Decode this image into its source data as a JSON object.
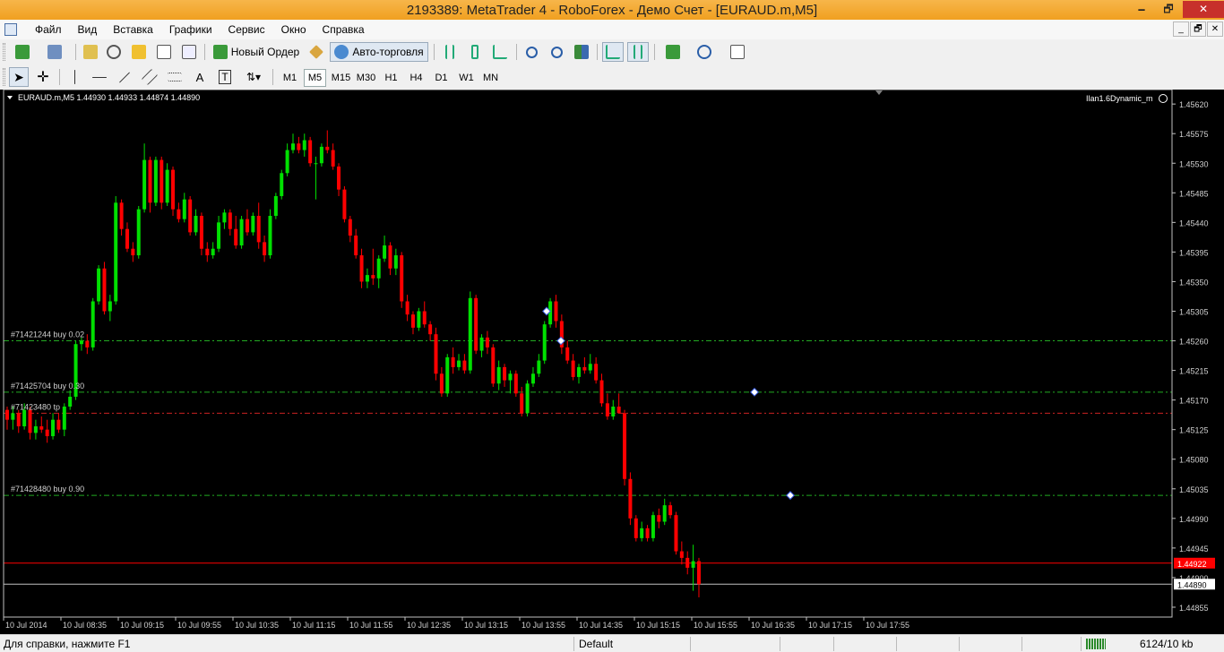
{
  "window": {
    "title": "2193389: MetaTrader 4 - RoboForex - Демо Счет - [EURAUD.m,M5]",
    "minimize": "🗕",
    "maximize": "🗗",
    "close": "✕"
  },
  "menu": {
    "items": [
      "Файл",
      "Вид",
      "Вставка",
      "Графики",
      "Сервис",
      "Окно",
      "Справка"
    ],
    "mdi": [
      "_",
      "🗗",
      "✕"
    ]
  },
  "toolbar": {
    "new_order": "Новый Ордер",
    "auto_trading": "Авто-торговля",
    "timeframes": [
      "M1",
      "M5",
      "M15",
      "M30",
      "H1",
      "H4",
      "D1",
      "W1",
      "MN"
    ],
    "active_timeframe": "M5",
    "search_placeholder": ""
  },
  "chart": {
    "header": "EURAUD.m,M5  1.44930 1.44933 1.44874 1.44890",
    "expert": "Ilan1.6Dynamic_m",
    "colors": {
      "background": "#000000",
      "bull": "#00e000",
      "bear": "#ff0000",
      "order_line": "#22aa22",
      "tp_line": "#cc2222",
      "bid_line": "#ff0000",
      "ask_line": "#c0c0c0"
    },
    "order_labels": [
      {
        "text": "#71421244 buy 0.02",
        "price": 1.4526
      },
      {
        "text": "#71425704 buy 0.30",
        "price": 1.45182
      },
      {
        "text": "#71423480 tp",
        "price": 1.4515
      },
      {
        "text": "#71428480 buy 0.90",
        "price": 1.45025
      }
    ],
    "bid_price_label": "1.44922",
    "ask_price_label": "1.44890",
    "bid_price": 1.44922,
    "ask_price": 1.4489,
    "price_ticks": [
      "1.45620",
      "1.45575",
      "1.45530",
      "1.45485",
      "1.45440",
      "1.45395",
      "1.45350",
      "1.45305",
      "1.45260",
      "1.45215",
      "1.45170",
      "1.45125",
      "1.45080",
      "1.45035",
      "1.44990",
      "1.44945",
      "1.44900",
      "1.44855"
    ],
    "time_ticks": [
      "10 Jul 2014",
      "10 Jul 08:35",
      "10 Jul 09:15",
      "10 Jul 09:55",
      "10 Jul 10:35",
      "10 Jul 11:15",
      "10 Jul 11:55",
      "10 Jul 12:35",
      "10 Jul 13:15",
      "10 Jul 13:55",
      "10 Jul 14:35",
      "10 Jul 15:15",
      "10 Jul 15:55",
      "10 Jul 16:35",
      "10 Jul 17:15",
      "10 Jul 17:55"
    ],
    "candles": [
      [
        1.45155,
        1.4516,
        1.45125,
        1.4514
      ],
      [
        1.4514,
        1.4516,
        1.45125,
        1.4515
      ],
      [
        1.4515,
        1.45155,
        1.4512,
        1.4513
      ],
      [
        1.4513,
        1.45165,
        1.45125,
        1.45155
      ],
      [
        1.45155,
        1.4516,
        1.4511,
        1.4512
      ],
      [
        1.4512,
        1.4514,
        1.4511,
        1.4513
      ],
      [
        1.4513,
        1.45145,
        1.4512,
        1.45125
      ],
      [
        1.45125,
        1.4514,
        1.45105,
        1.45115
      ],
      [
        1.45115,
        1.4515,
        1.4511,
        1.4514
      ],
      [
        1.4514,
        1.4515,
        1.4512,
        1.45125
      ],
      [
        1.45125,
        1.45165,
        1.45115,
        1.4516
      ],
      [
        1.4516,
        1.45185,
        1.45155,
        1.45175
      ],
      [
        1.45175,
        1.4526,
        1.4517,
        1.45255
      ],
      [
        1.45255,
        1.45265,
        1.45245,
        1.4526
      ],
      [
        1.4526,
        1.4527,
        1.4524,
        1.4525
      ],
      [
        1.4525,
        1.45325,
        1.45245,
        1.4532
      ],
      [
        1.4532,
        1.45375,
        1.45315,
        1.4537
      ],
      [
        1.4537,
        1.4538,
        1.453,
        1.45305
      ],
      [
        1.45305,
        1.4533,
        1.4529,
        1.4532
      ],
      [
        1.4532,
        1.4548,
        1.45315,
        1.4547
      ],
      [
        1.4547,
        1.45475,
        1.4542,
        1.4543
      ],
      [
        1.4543,
        1.4544,
        1.45395,
        1.454
      ],
      [
        1.454,
        1.4541,
        1.4538,
        1.4539
      ],
      [
        1.4539,
        1.45465,
        1.45385,
        1.4546
      ],
      [
        1.4546,
        1.4556,
        1.45455,
        1.45535
      ],
      [
        1.45535,
        1.4554,
        1.45455,
        1.4547
      ],
      [
        1.4547,
        1.4554,
        1.45465,
        1.45535
      ],
      [
        1.45535,
        1.4554,
        1.4546,
        1.4547
      ],
      [
        1.4547,
        1.4553,
        1.45465,
        1.4552
      ],
      [
        1.4552,
        1.45525,
        1.4545,
        1.4546
      ],
      [
        1.4546,
        1.4547,
        1.4544,
        1.45445
      ],
      [
        1.45445,
        1.45485,
        1.4544,
        1.45475
      ],
      [
        1.45475,
        1.4548,
        1.4542,
        1.45425
      ],
      [
        1.45425,
        1.4546,
        1.4542,
        1.4545
      ],
      [
        1.4545,
        1.45455,
        1.4539,
        1.454
      ],
      [
        1.454,
        1.4541,
        1.4538,
        1.4539
      ],
      [
        1.4539,
        1.4541,
        1.45385,
        1.454
      ],
      [
        1.454,
        1.4545,
        1.45395,
        1.4544
      ],
      [
        1.4544,
        1.4546,
        1.4543,
        1.45455
      ],
      [
        1.45455,
        1.4546,
        1.4542,
        1.4543
      ],
      [
        1.4543,
        1.4545,
        1.454,
        1.45405
      ],
      [
        1.45405,
        1.4545,
        1.454,
        1.45445
      ],
      [
        1.45445,
        1.4546,
        1.4542,
        1.45425
      ],
      [
        1.45425,
        1.45455,
        1.4542,
        1.4545
      ],
      [
        1.4545,
        1.4547,
        1.454,
        1.4541
      ],
      [
        1.4541,
        1.4542,
        1.4538,
        1.4539
      ],
      [
        1.4539,
        1.4546,
        1.45385,
        1.4545
      ],
      [
        1.4545,
        1.45485,
        1.45445,
        1.4548
      ],
      [
        1.4548,
        1.4552,
        1.45475,
        1.45515
      ],
      [
        1.45515,
        1.4556,
        1.4551,
        1.4555
      ],
      [
        1.4555,
        1.45575,
        1.45545,
        1.4556
      ],
      [
        1.4556,
        1.4557,
        1.45545,
        1.4555
      ],
      [
        1.4555,
        1.45575,
        1.4554,
        1.45565
      ],
      [
        1.45565,
        1.4557,
        1.45525,
        1.4553
      ],
      [
        1.4553,
        1.4554,
        1.45475,
        1.4553
      ],
      [
        1.4553,
        1.4556,
        1.45525,
        1.45555
      ],
      [
        1.45555,
        1.4558,
        1.45545,
        1.4555
      ],
      [
        1.4555,
        1.4556,
        1.4552,
        1.45525
      ],
      [
        1.45525,
        1.4553,
        1.4548,
        1.4549
      ],
      [
        1.4549,
        1.45495,
        1.4544,
        1.45445
      ],
      [
        1.45445,
        1.4545,
        1.4541,
        1.4542
      ],
      [
        1.4542,
        1.4543,
        1.45385,
        1.4539
      ],
      [
        1.4539,
        1.454,
        1.4534,
        1.4535
      ],
      [
        1.4535,
        1.4537,
        1.4534,
        1.4536
      ],
      [
        1.4536,
        1.454,
        1.45345,
        1.45355
      ],
      [
        1.45355,
        1.4539,
        1.4534,
        1.45385
      ],
      [
        1.45385,
        1.4542,
        1.4538,
        1.45405
      ],
      [
        1.45405,
        1.4541,
        1.4536,
        1.4537
      ],
      [
        1.4537,
        1.454,
        1.4536,
        1.4539
      ],
      [
        1.4539,
        1.45395,
        1.4531,
        1.4532
      ],
      [
        1.4532,
        1.4533,
        1.4529,
        1.453
      ],
      [
        1.453,
        1.45305,
        1.4527,
        1.4528
      ],
      [
        1.4528,
        1.4531,
        1.45275,
        1.45305
      ],
      [
        1.45305,
        1.4532,
        1.4528,
        1.45285
      ],
      [
        1.45285,
        1.4529,
        1.4526,
        1.4527
      ],
      [
        1.4527,
        1.4528,
        1.452,
        1.4521
      ],
      [
        1.4521,
        1.4522,
        1.45175,
        1.4518
      ],
      [
        1.4518,
        1.4524,
        1.45175,
        1.45235
      ],
      [
        1.45235,
        1.4525,
        1.4521,
        1.4522
      ],
      [
        1.4522,
        1.4524,
        1.45215,
        1.4523
      ],
      [
        1.4523,
        1.4524,
        1.4521,
        1.45215
      ],
      [
        1.45215,
        1.45335,
        1.4521,
        1.45325
      ],
      [
        1.45325,
        1.4533,
        1.4524,
        1.45245
      ],
      [
        1.45245,
        1.4527,
        1.45235,
        1.45265
      ],
      [
        1.45265,
        1.45275,
        1.4524,
        1.4525
      ],
      [
        1.4525,
        1.45255,
        1.4519,
        1.45195
      ],
      [
        1.45195,
        1.4523,
        1.45185,
        1.4522
      ],
      [
        1.4522,
        1.45225,
        1.4519,
        1.452
      ],
      [
        1.452,
        1.45215,
        1.4518,
        1.4521
      ],
      [
        1.4521,
        1.45215,
        1.45175,
        1.4518
      ],
      [
        1.4518,
        1.4519,
        1.45145,
        1.4515
      ],
      [
        1.4515,
        1.452,
        1.45145,
        1.45195
      ],
      [
        1.45195,
        1.4522,
        1.4519,
        1.4521
      ],
      [
        1.4521,
        1.4524,
        1.45205,
        1.4523
      ],
      [
        1.4523,
        1.4529,
        1.45225,
        1.45285
      ],
      [
        1.45285,
        1.45325,
        1.4528,
        1.4532
      ],
      [
        1.4532,
        1.4533,
        1.4528,
        1.4529
      ],
      [
        1.4529,
        1.453,
        1.4524,
        1.4525
      ],
      [
        1.4525,
        1.4526,
        1.45225,
        1.4523
      ],
      [
        1.4523,
        1.4524,
        1.452,
        1.45205
      ],
      [
        1.45205,
        1.45225,
        1.45195,
        1.4522
      ],
      [
        1.4522,
        1.45235,
        1.4521,
        1.45215
      ],
      [
        1.45215,
        1.4524,
        1.4521,
        1.45225
      ],
      [
        1.45225,
        1.45235,
        1.45195,
        1.452
      ],
      [
        1.452,
        1.4521,
        1.4516,
        1.45165
      ],
      [
        1.45165,
        1.4518,
        1.4514,
        1.45145
      ],
      [
        1.45145,
        1.4517,
        1.4514,
        1.4516
      ],
      [
        1.4516,
        1.4518,
        1.4515,
        1.4515
      ],
      [
        1.4515,
        1.45155,
        1.4504,
        1.4505
      ],
      [
        1.4505,
        1.4506,
        1.4498,
        1.4499
      ],
      [
        1.4499,
        1.44995,
        1.44955,
        1.4496
      ],
      [
        1.4496,
        1.44985,
        1.44955,
        1.44975
      ],
      [
        1.44975,
        1.4498,
        1.44955,
        1.4496
      ],
      [
        1.4496,
        1.45,
        1.44955,
        1.44995
      ],
      [
        1.44995,
        1.45005,
        1.44975,
        1.44985
      ],
      [
        1.44985,
        1.4502,
        1.4498,
        1.4501
      ],
      [
        1.4501,
        1.45015,
        1.4499,
        1.44995
      ],
      [
        1.44995,
        1.45,
        1.44935,
        1.4494
      ],
      [
        1.4494,
        1.44955,
        1.4492,
        1.4493
      ],
      [
        1.4493,
        1.4494,
        1.44905,
        1.44915
      ],
      [
        1.44915,
        1.4495,
        1.4488,
        1.44925
      ],
      [
        1.44925,
        1.4493,
        1.4487,
        1.4489
      ]
    ]
  },
  "status": {
    "help": "Для справки, нажмите F1",
    "profile": "Default",
    "traffic": "6124/10 kb"
  }
}
